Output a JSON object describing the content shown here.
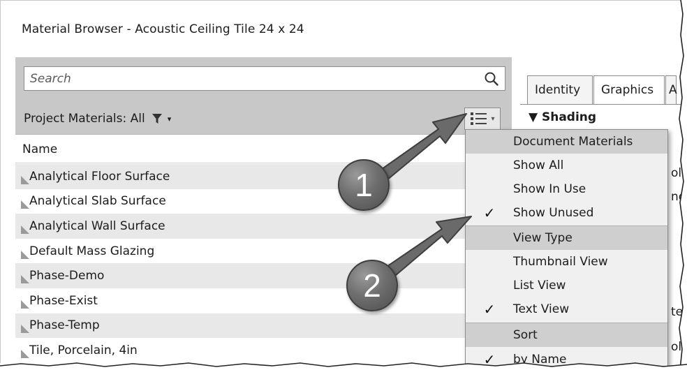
{
  "window": {
    "title": "Material Browser - Acoustic Ceiling Tile 24 x 24"
  },
  "search": {
    "placeholder": "Search"
  },
  "filter": {
    "label": "Project Materials: All"
  },
  "list": {
    "column_header": "Name",
    "items": [
      "Analytical Floor Surface",
      "Analytical Slab Surface",
      "Analytical Wall Surface",
      "Default Mass Glazing",
      "Phase-Demo",
      "Phase-Exist",
      "Phase-Temp",
      "Tile, Porcelain, 4in"
    ]
  },
  "tabs": [
    {
      "label": "Identity"
    },
    {
      "label": "Graphics"
    },
    {
      "label": "A"
    }
  ],
  "right_panel": {
    "section": "▼ Shading",
    "peek": [
      "olo",
      "nd",
      "te",
      "olo"
    ]
  },
  "menu": {
    "items": [
      {
        "label": "Document Materials",
        "header": true,
        "checked": false
      },
      {
        "label": "Show All",
        "header": false,
        "checked": false
      },
      {
        "label": "Show In Use",
        "header": false,
        "checked": false
      },
      {
        "label": "Show Unused",
        "header": false,
        "checked": true
      },
      {
        "label": "View Type",
        "header": true,
        "checked": false
      },
      {
        "label": "Thumbnail View",
        "header": false,
        "checked": false
      },
      {
        "label": "List View",
        "header": false,
        "checked": false
      },
      {
        "label": "Text View",
        "header": false,
        "checked": true
      },
      {
        "label": "Sort",
        "header": true,
        "checked": false
      },
      {
        "label": "by Name",
        "header": false,
        "checked": true
      }
    ],
    "check_glyph": "✓"
  },
  "annotations": [
    {
      "number": "1"
    },
    {
      "number": "2"
    }
  ],
  "colors": {
    "panel_gray": "#c8c8c8",
    "row_alt": "#e8e8e8",
    "menu_bg": "#f0f0f0",
    "menu_header": "#cfcfcf",
    "bubble": "#6e6e6e"
  }
}
